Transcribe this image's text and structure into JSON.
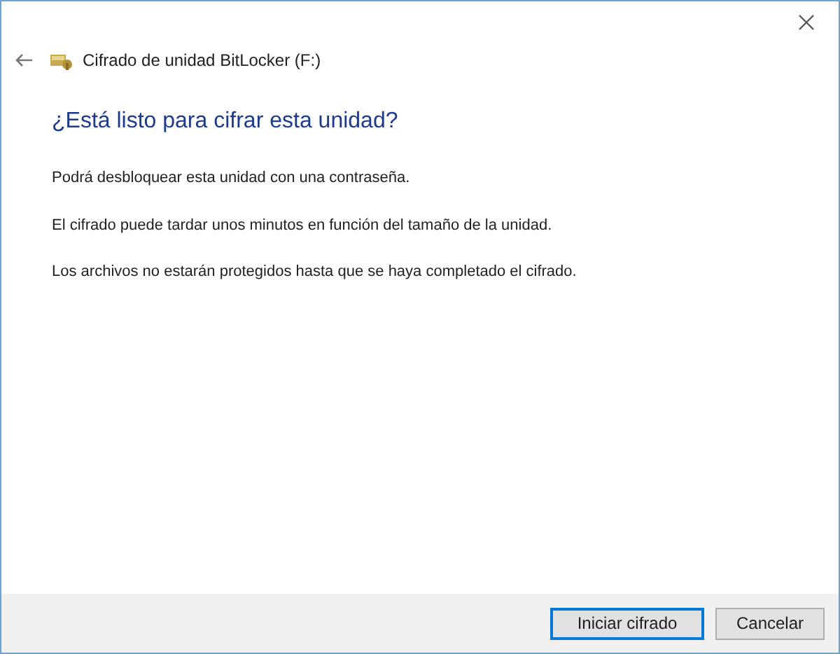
{
  "window": {
    "title": "Cifrado de unidad BitLocker (F:)"
  },
  "heading": "¿Está listo para cifrar esta unidad?",
  "paragraphs": [
    "Podrá desbloquear esta unidad con una contraseña.",
    "El cifrado puede tardar unos minutos en función del tamaño de la unidad.",
    "Los archivos no estarán protegidos hasta que se haya completado el cifrado."
  ],
  "buttons": [
    {
      "label": "Iniciar cifrado",
      "default": true
    },
    {
      "label": "Cancelar",
      "default": false
    }
  ]
}
